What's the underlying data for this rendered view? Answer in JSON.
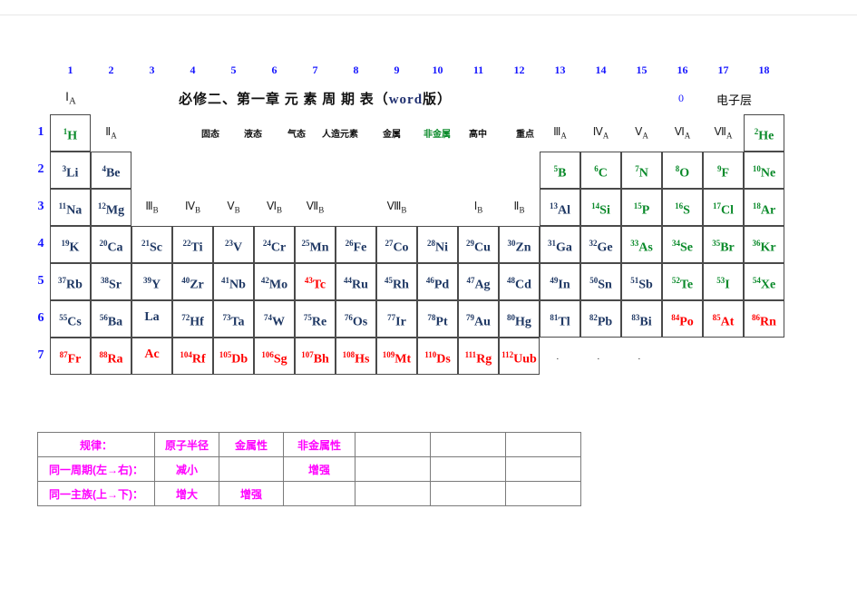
{
  "page": {
    "title": "必修二、第一章  元 素 周 期 表（word版）",
    "title_main": "必修二、第一章  元 素 周 期 表（",
    "title_word": "word",
    "title_tail": "版）",
    "zero_group": "0",
    "shell_label": "电子层"
  },
  "column_numbers": [
    "1",
    "2",
    "3",
    "4",
    "5",
    "6",
    "7",
    "8",
    "9",
    "10",
    "11",
    "12",
    "13",
    "14",
    "15",
    "16",
    "17",
    "18"
  ],
  "period_numbers": [
    "1",
    "2",
    "3",
    "4",
    "5",
    "6",
    "7"
  ],
  "legend": [
    {
      "label": "固态",
      "color": "#111111"
    },
    {
      "label": "液态",
      "color": "#111111"
    },
    {
      "label": "气态",
      "color": "#111111"
    },
    {
      "label": "人造元素",
      "color": "#111111"
    },
    {
      "label": "金属",
      "color": "#111111"
    },
    {
      "label": "非金属",
      "color": "#0a8a2a"
    },
    {
      "label": "高中",
      "color": "#111111"
    },
    {
      "label": "重点",
      "color": "#111111"
    }
  ],
  "group_labels_a": [
    {
      "main": "Ⅰ",
      "sub": "A",
      "col": 1,
      "row": "above"
    },
    {
      "main": "Ⅱ",
      "sub": "A",
      "col": 2,
      "row": 1
    },
    {
      "main": "Ⅲ",
      "sub": "A",
      "col": 13,
      "row": 1
    },
    {
      "main": "Ⅳ",
      "sub": "A",
      "col": 14,
      "row": 1
    },
    {
      "main": "Ⅴ",
      "sub": "A",
      "col": 15,
      "row": 1
    },
    {
      "main": "Ⅵ",
      "sub": "A",
      "col": 16,
      "row": 1
    },
    {
      "main": "Ⅶ",
      "sub": "A",
      "col": 17,
      "row": 1
    }
  ],
  "group_labels_b": [
    {
      "main": "Ⅲ",
      "sub": "B",
      "col": 3
    },
    {
      "main": "Ⅳ",
      "sub": "B",
      "col": 4
    },
    {
      "main": "Ⅴ",
      "sub": "B",
      "col": 5
    },
    {
      "main": "Ⅵ",
      "sub": "B",
      "col": 6
    },
    {
      "main": "Ⅶ",
      "sub": "B",
      "col": 7
    },
    {
      "main": "Ⅷ",
      "sub": "B",
      "col": 9
    },
    {
      "main": "Ⅰ",
      "sub": "B",
      "col": 11
    },
    {
      "main": "Ⅱ",
      "sub": "B",
      "col": 12
    }
  ],
  "colors": {
    "metal": "#1f3864",
    "nonmetal": "#0a8a2a",
    "artificial": "#ff0000",
    "period_number": "#1616ff",
    "column_number": "#1616ff",
    "rules_text": "#ff00ff"
  },
  "elements": [
    {
      "num": "1",
      "sym": "H",
      "row": 1,
      "col": 1,
      "type": "nonmetal"
    },
    {
      "num": "2",
      "sym": "He",
      "row": 1,
      "col": 18,
      "type": "nonmetal"
    },
    {
      "num": "3",
      "sym": "Li",
      "row": 2,
      "col": 1,
      "type": "metal"
    },
    {
      "num": "4",
      "sym": "Be",
      "row": 2,
      "col": 2,
      "type": "metal"
    },
    {
      "num": "5",
      "sym": "B",
      "row": 2,
      "col": 13,
      "type": "nonmetal"
    },
    {
      "num": "6",
      "sym": "C",
      "row": 2,
      "col": 14,
      "type": "nonmetal"
    },
    {
      "num": "7",
      "sym": "N",
      "row": 2,
      "col": 15,
      "type": "nonmetal"
    },
    {
      "num": "8",
      "sym": "O",
      "row": 2,
      "col": 16,
      "type": "nonmetal"
    },
    {
      "num": "9",
      "sym": "F",
      "row": 2,
      "col": 17,
      "type": "nonmetal"
    },
    {
      "num": "10",
      "sym": "Ne",
      "row": 2,
      "col": 18,
      "type": "nonmetal"
    },
    {
      "num": "11",
      "sym": "Na",
      "row": 3,
      "col": 1,
      "type": "metal"
    },
    {
      "num": "12",
      "sym": "Mg",
      "row": 3,
      "col": 2,
      "type": "metal"
    },
    {
      "num": "13",
      "sym": "Al",
      "row": 3,
      "col": 13,
      "type": "metal"
    },
    {
      "num": "14",
      "sym": "Si",
      "row": 3,
      "col": 14,
      "type": "nonmetal"
    },
    {
      "num": "15",
      "sym": "P",
      "row": 3,
      "col": 15,
      "type": "nonmetal"
    },
    {
      "num": "16",
      "sym": "S",
      "row": 3,
      "col": 16,
      "type": "nonmetal"
    },
    {
      "num": "17",
      "sym": "Cl",
      "row": 3,
      "col": 17,
      "type": "nonmetal"
    },
    {
      "num": "18",
      "sym": "Ar",
      "row": 3,
      "col": 18,
      "type": "nonmetal"
    },
    {
      "num": "19",
      "sym": "K",
      "row": 4,
      "col": 1,
      "type": "metal"
    },
    {
      "num": "20",
      "sym": "Ca",
      "row": 4,
      "col": 2,
      "type": "metal"
    },
    {
      "num": "21",
      "sym": "Sc",
      "row": 4,
      "col": 3,
      "type": "metal"
    },
    {
      "num": "22",
      "sym": "Ti",
      "row": 4,
      "col": 4,
      "type": "metal"
    },
    {
      "num": "23",
      "sym": "V",
      "row": 4,
      "col": 5,
      "type": "metal"
    },
    {
      "num": "24",
      "sym": "Cr",
      "row": 4,
      "col": 6,
      "type": "metal"
    },
    {
      "num": "25",
      "sym": "Mn",
      "row": 4,
      "col": 7,
      "type": "metal"
    },
    {
      "num": "26",
      "sym": "Fe",
      "row": 4,
      "col": 8,
      "type": "metal"
    },
    {
      "num": "27",
      "sym": "Co",
      "row": 4,
      "col": 9,
      "type": "metal"
    },
    {
      "num": "28",
      "sym": "Ni",
      "row": 4,
      "col": 10,
      "type": "metal"
    },
    {
      "num": "29",
      "sym": "Cu",
      "row": 4,
      "col": 11,
      "type": "metal"
    },
    {
      "num": "30",
      "sym": "Zn",
      "row": 4,
      "col": 12,
      "type": "metal"
    },
    {
      "num": "31",
      "sym": "Ga",
      "row": 4,
      "col": 13,
      "type": "metal"
    },
    {
      "num": "32",
      "sym": "Ge",
      "row": 4,
      "col": 14,
      "type": "metal"
    },
    {
      "num": "33",
      "sym": "As",
      "row": 4,
      "col": 15,
      "type": "nonmetal"
    },
    {
      "num": "34",
      "sym": "Se",
      "row": 4,
      "col": 16,
      "type": "nonmetal"
    },
    {
      "num": "35",
      "sym": "Br",
      "row": 4,
      "col": 17,
      "type": "nonmetal"
    },
    {
      "num": "36",
      "sym": "Kr",
      "row": 4,
      "col": 18,
      "type": "nonmetal"
    },
    {
      "num": "37",
      "sym": "Rb",
      "row": 5,
      "col": 1,
      "type": "metal"
    },
    {
      "num": "38",
      "sym": "Sr",
      "row": 5,
      "col": 2,
      "type": "metal"
    },
    {
      "num": "39",
      "sym": "Y",
      "row": 5,
      "col": 3,
      "type": "metal"
    },
    {
      "num": "40",
      "sym": "Zr",
      "row": 5,
      "col": 4,
      "type": "metal"
    },
    {
      "num": "41",
      "sym": "Nb",
      "row": 5,
      "col": 5,
      "type": "metal"
    },
    {
      "num": "42",
      "sym": "Mo",
      "row": 5,
      "col": 6,
      "type": "metal"
    },
    {
      "num": "43",
      "sym": "Tc",
      "row": 5,
      "col": 7,
      "type": "artificial"
    },
    {
      "num": "44",
      "sym": "Ru",
      "row": 5,
      "col": 8,
      "type": "metal"
    },
    {
      "num": "45",
      "sym": "Rh",
      "row": 5,
      "col": 9,
      "type": "metal"
    },
    {
      "num": "46",
      "sym": "Pd",
      "row": 5,
      "col": 10,
      "type": "metal"
    },
    {
      "num": "47",
      "sym": "Ag",
      "row": 5,
      "col": 11,
      "type": "metal"
    },
    {
      "num": "48",
      "sym": "Cd",
      "row": 5,
      "col": 12,
      "type": "metal"
    },
    {
      "num": "49",
      "sym": "In",
      "row": 5,
      "col": 13,
      "type": "metal"
    },
    {
      "num": "50",
      "sym": "Sn",
      "row": 5,
      "col": 14,
      "type": "metal"
    },
    {
      "num": "51",
      "sym": "Sb",
      "row": 5,
      "col": 15,
      "type": "metal"
    },
    {
      "num": "52",
      "sym": "Te",
      "row": 5,
      "col": 16,
      "type": "nonmetal"
    },
    {
      "num": "53",
      "sym": "I",
      "row": 5,
      "col": 17,
      "type": "nonmetal"
    },
    {
      "num": "54",
      "sym": "Xe",
      "row": 5,
      "col": 18,
      "type": "nonmetal"
    },
    {
      "num": "55",
      "sym": "Cs",
      "row": 6,
      "col": 1,
      "type": "metal"
    },
    {
      "num": "56",
      "sym": "Ba",
      "row": 6,
      "col": 2,
      "type": "metal"
    },
    {
      "num": "",
      "sym": "La",
      "row": 6,
      "col": 3,
      "type": "metal"
    },
    {
      "num": "72",
      "sym": "Hf",
      "row": 6,
      "col": 4,
      "type": "metal"
    },
    {
      "num": "73",
      "sym": "Ta",
      "row": 6,
      "col": 5,
      "type": "metal"
    },
    {
      "num": "74",
      "sym": "W",
      "row": 6,
      "col": 6,
      "type": "metal"
    },
    {
      "num": "75",
      "sym": "Re",
      "row": 6,
      "col": 7,
      "type": "metal"
    },
    {
      "num": "76",
      "sym": "Os",
      "row": 6,
      "col": 8,
      "type": "metal"
    },
    {
      "num": "77",
      "sym": "Ir",
      "row": 6,
      "col": 9,
      "type": "metal"
    },
    {
      "num": "78",
      "sym": "Pt",
      "row": 6,
      "col": 10,
      "type": "metal"
    },
    {
      "num": "79",
      "sym": "Au",
      "row": 6,
      "col": 11,
      "type": "metal"
    },
    {
      "num": "80",
      "sym": "Hg",
      "row": 6,
      "col": 12,
      "type": "metal"
    },
    {
      "num": "81",
      "sym": "Tl",
      "row": 6,
      "col": 13,
      "type": "metal"
    },
    {
      "num": "82",
      "sym": "Pb",
      "row": 6,
      "col": 14,
      "type": "metal"
    },
    {
      "num": "83",
      "sym": "Bi",
      "row": 6,
      "col": 15,
      "type": "metal"
    },
    {
      "num": "84",
      "sym": "Po",
      "row": 6,
      "col": 16,
      "type": "artificial"
    },
    {
      "num": "85",
      "sym": "At",
      "row": 6,
      "col": 17,
      "type": "artificial"
    },
    {
      "num": "86",
      "sym": "Rn",
      "row": 6,
      "col": 18,
      "type": "artificial"
    },
    {
      "num": "87",
      "sym": "Fr",
      "row": 7,
      "col": 1,
      "type": "artificial"
    },
    {
      "num": "88",
      "sym": "Ra",
      "row": 7,
      "col": 2,
      "type": "artificial"
    },
    {
      "num": "",
      "sym": "Ac",
      "row": 7,
      "col": 3,
      "type": "artificial"
    },
    {
      "num": "104",
      "sym": "Rf",
      "row": 7,
      "col": 4,
      "type": "artificial"
    },
    {
      "num": "105",
      "sym": "Db",
      "row": 7,
      "col": 5,
      "type": "artificial"
    },
    {
      "num": "106",
      "sym": "Sg",
      "row": 7,
      "col": 6,
      "type": "artificial"
    },
    {
      "num": "107",
      "sym": "Bh",
      "row": 7,
      "col": 7,
      "type": "artificial"
    },
    {
      "num": "108",
      "sym": "Hs",
      "row": 7,
      "col": 8,
      "type": "artificial"
    },
    {
      "num": "109",
      "sym": "Mt",
      "row": 7,
      "col": 9,
      "type": "artificial"
    },
    {
      "num": "110",
      "sym": "Ds",
      "row": 7,
      "col": 10,
      "type": "artificial"
    },
    {
      "num": "111",
      "sym": "Rg",
      "row": 7,
      "col": 11,
      "type": "artificial"
    },
    {
      "num": "112",
      "sym": "Uub",
      "row": 7,
      "col": 12,
      "type": "artificial"
    }
  ],
  "trailing_dots": [
    "·",
    "·",
    "·"
  ],
  "rules_table": {
    "header": [
      "规律：",
      "原子半径",
      "金属性",
      "非金属性",
      "",
      "",
      ""
    ],
    "rows": [
      [
        "同一周期(左→右)：",
        "减小",
        "",
        "增强",
        "",
        "",
        ""
      ],
      [
        "同一主族(上→下)：",
        "增大",
        "增强",
        "",
        "",
        "",
        ""
      ]
    ]
  }
}
